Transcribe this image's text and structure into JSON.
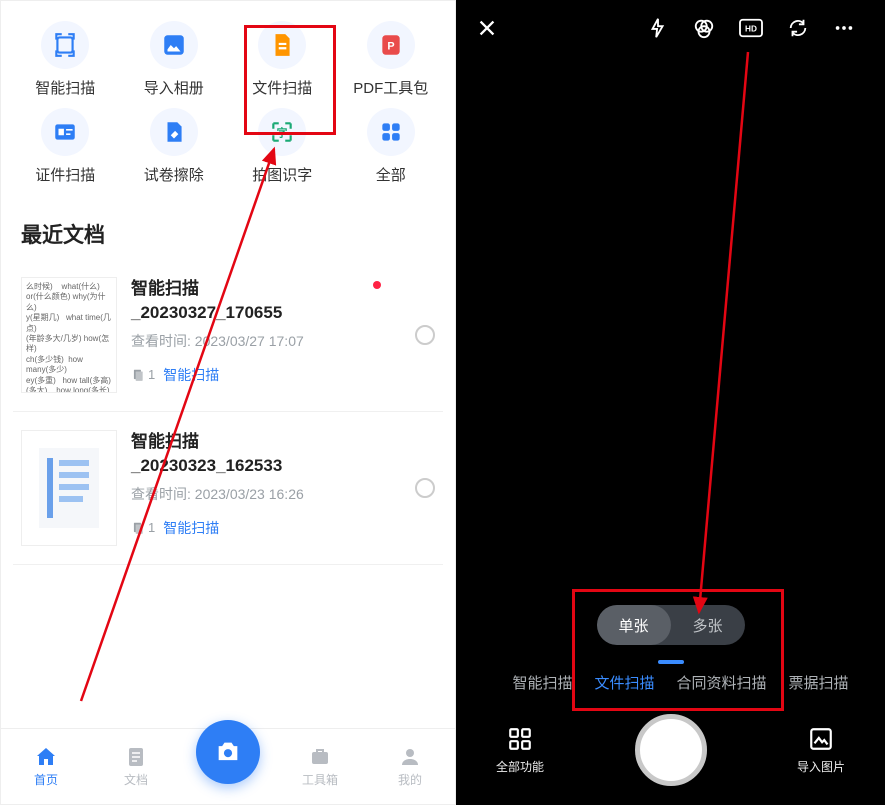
{
  "left": {
    "funcs": [
      {
        "label": "智能扫描"
      },
      {
        "label": "导入相册"
      },
      {
        "label": "文件扫描"
      },
      {
        "label": "PDF工具包"
      },
      {
        "label": "证件扫描"
      },
      {
        "label": "试卷擦除"
      },
      {
        "label": "拍图识字"
      },
      {
        "label": "全部"
      }
    ],
    "section_title": "最近文档",
    "docs": [
      {
        "title_a": "智能扫描",
        "title_b": "_20230327_170655",
        "time": "查看时间: 2023/03/27 17:07",
        "count": "1",
        "tag": "智能扫描",
        "thumb_text": "么时候)    what(什么)\nor(什么颜色) why(为什么)\ny(星期几)   what time(几点)\n(年龄多大/几岁) how(怎样)\nch(多少钱)  how many(多少)\ney(多重)   how tall(多高)\n(多大)    how long(多长)\nge(更哥多大) where(在哪里)\n  whose(谁的) which(哪一个)\n    修改前    修改后"
      },
      {
        "title_a": "智能扫描",
        "title_b": "_20230323_162533",
        "time": "查看时间: 2023/03/23 16:26",
        "count": "1",
        "tag": "智能扫描"
      }
    ],
    "nav": [
      {
        "label": "首页"
      },
      {
        "label": "文档"
      },
      {
        "label": "工具箱"
      },
      {
        "label": "我的"
      }
    ]
  },
  "right": {
    "count_options": [
      {
        "label": "单张",
        "active": true
      },
      {
        "label": "多张",
        "active": false
      }
    ],
    "modes": [
      {
        "label": "智能扫描"
      },
      {
        "label": "文件扫描",
        "active": true
      },
      {
        "label": "合同资料扫描"
      },
      {
        "label": "票据扫描"
      }
    ],
    "bottom": {
      "all_funcs": "全部功能",
      "import": "导入图片"
    }
  }
}
